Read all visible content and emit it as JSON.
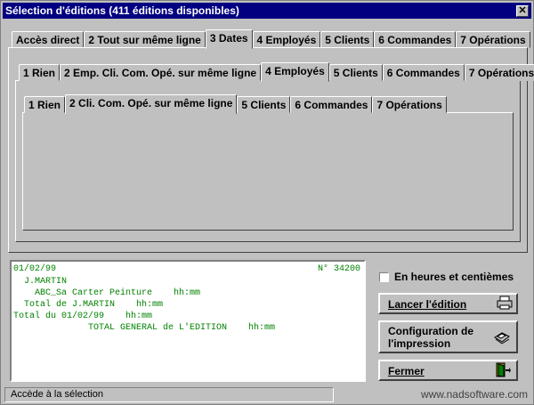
{
  "window": {
    "title": "Sélection d'éditions (411 éditions disponibles)"
  },
  "tabs_level1": [
    {
      "label": "Accès direct",
      "active": false
    },
    {
      "label": "2 Tout sur même ligne",
      "active": false
    },
    {
      "label": "3 Dates",
      "active": true
    },
    {
      "label": "4 Employés",
      "active": false
    },
    {
      "label": "5 Clients",
      "active": false
    },
    {
      "label": "6 Commandes",
      "active": false
    },
    {
      "label": "7 Opérations",
      "active": false
    }
  ],
  "tabs_level2": [
    {
      "label": "1 Rien",
      "active": false
    },
    {
      "label": "2 Emp. Cli. Com. Opé. sur même ligne",
      "active": false
    },
    {
      "label": "4 Employés",
      "active": true
    },
    {
      "label": "5 Clients",
      "active": false
    },
    {
      "label": "6 Commandes",
      "active": false
    },
    {
      "label": "7 Opérations",
      "active": false
    }
  ],
  "tabs_level3": [
    {
      "label": "1 Rien",
      "active": false
    },
    {
      "label": "2 Cli. Com. Opé. sur même ligne",
      "active": true
    },
    {
      "label": "5 Clients",
      "active": false
    },
    {
      "label": "6 Commandes",
      "active": false
    },
    {
      "label": "7 Opérations",
      "active": false
    }
  ],
  "preview": {
    "date": "01/02/99",
    "number": "N° 34200",
    "employee": "J.MARTIN",
    "line_client": "ABC_Sa Carter Peinture    hh:mm",
    "total_employee": "Total de J.MARTIN    hh:mm",
    "total_date": "Total du 01/02/99    hh:mm",
    "grand_total": "TOTAL GENERAL de L'EDITION    hh:mm"
  },
  "options": {
    "hours_checkbox_label": "En heures et centièmes",
    "hours_checked": false
  },
  "buttons": {
    "launch": "Lancer l'édition",
    "config_line1": "Configuration de",
    "config_line2": "l'impression",
    "close": "Fermer"
  },
  "icons": {
    "launch": "printer-icon",
    "config": "printer-settings-icon",
    "close": "exit-door-icon"
  },
  "status": {
    "left": "Accède à la sélection",
    "right": "www.nadsoftware.com"
  }
}
